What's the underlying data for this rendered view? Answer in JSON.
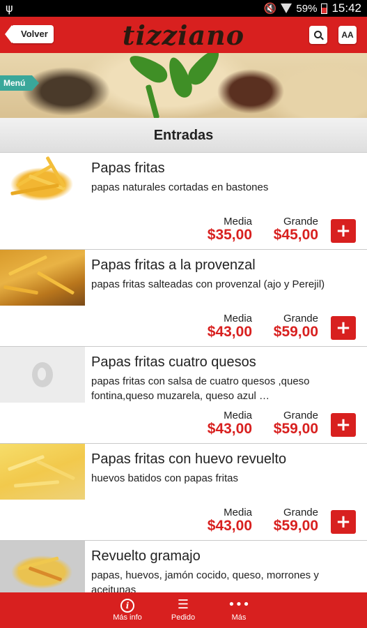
{
  "status_bar": {
    "battery": "59%",
    "time": "15:42"
  },
  "header": {
    "back_label": "Volver",
    "logo": "tizziano",
    "font_button": "AA"
  },
  "banner": {
    "menu_tab": "Menú"
  },
  "section": {
    "title": "Entradas"
  },
  "price_labels": {
    "media": "Media",
    "grande": "Grande"
  },
  "items": [
    {
      "name": "Papas fritas",
      "description": "papas naturales cortadas en bastones",
      "media": "$35,00",
      "grande": "$45,00"
    },
    {
      "name": "Papas fritas a la provenzal",
      "description": "papas fritas salteadas con provenzal (ajo y Perejil)",
      "media": "$43,00",
      "grande": "$59,00"
    },
    {
      "name": "Papas fritas cuatro quesos",
      "description": "papas fritas con salsa  de cuatro quesos ,queso fontina,queso muzarela, queso azul …",
      "media": "$43,00",
      "grande": "$59,00"
    },
    {
      "name": "Papas fritas con huevo revuelto",
      "description": "huevos batidos con papas fritas",
      "media": "$43,00",
      "grande": "$59,00"
    },
    {
      "name": "Revuelto gramajo",
      "description": "papas, huevos, jamón cocido, queso, morrones y aceitunas"
    }
  ],
  "bottom_nav": [
    {
      "label": "Más info",
      "icon": "info-icon"
    },
    {
      "label": "Pedido",
      "icon": "list-icon"
    },
    {
      "label": "Más",
      "icon": "more-icon"
    }
  ],
  "colors": {
    "brand_red": "#d8201f",
    "menu_tab": "#3aa79a"
  }
}
